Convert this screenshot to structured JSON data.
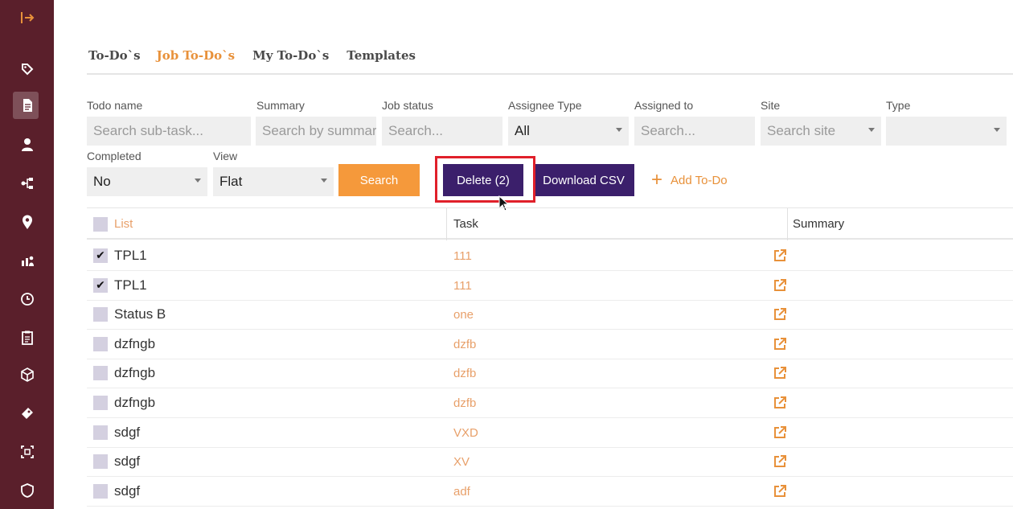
{
  "tabs": [
    {
      "label": "To-Do`s",
      "active": false
    },
    {
      "label": "Job To-Do`s",
      "active": true
    },
    {
      "label": "My To-Do`s",
      "active": false
    },
    {
      "label": "Templates",
      "active": false
    }
  ],
  "filters": {
    "todo_name": {
      "label": "Todo name",
      "placeholder": "Search sub-task..."
    },
    "summary": {
      "label": "Summary",
      "placeholder": "Search by summary"
    },
    "job_status": {
      "label": "Job status",
      "placeholder": "Search..."
    },
    "assignee_type": {
      "label": "Assignee Type",
      "value": "All"
    },
    "assigned_to": {
      "label": "Assigned to",
      "placeholder": "Search..."
    },
    "site": {
      "label": "Site",
      "placeholder": "Search site"
    },
    "type": {
      "label": "Type",
      "value": ""
    },
    "completed": {
      "label": "Completed",
      "value": "No"
    },
    "view": {
      "label": "View",
      "value": "Flat"
    }
  },
  "buttons": {
    "search": "Search",
    "delete": "Delete (2)",
    "download_csv": "Download CSV",
    "add_todo": "Add To-Do"
  },
  "table": {
    "headers": {
      "list": "List",
      "task": "Task",
      "summary": "Summary"
    },
    "rows": [
      {
        "list": "TPL1",
        "task": "111",
        "checked": true
      },
      {
        "list": "TPL1",
        "task": "111",
        "checked": true
      },
      {
        "list": "Status B",
        "task": "one",
        "checked": false
      },
      {
        "list": "dzfngb",
        "task": "dzfb",
        "checked": false
      },
      {
        "list": "dzfngb",
        "task": "dzfb",
        "checked": false
      },
      {
        "list": "dzfngb",
        "task": "dzfb",
        "checked": false
      },
      {
        "list": "sdgf",
        "task": "VXD",
        "checked": false
      },
      {
        "list": "sdgf",
        "task": "XV",
        "checked": false
      },
      {
        "list": "sdgf",
        "task": "adf",
        "checked": false
      }
    ]
  },
  "colors": {
    "sidebar": "#5a1f2b",
    "accent": "#e8913a",
    "primary_button": "#3b1f6b",
    "highlight": "#e0202a"
  },
  "sidebar_icons": [
    "logout-arrow-icon",
    "tag-icon",
    "document-icon",
    "user-icon",
    "hierarchy-icon",
    "location-pin-icon",
    "chart-people-icon",
    "clock-icon",
    "clipboard-icon",
    "cube-icon",
    "ticket-icon",
    "scan-icon",
    "shield-icon"
  ]
}
